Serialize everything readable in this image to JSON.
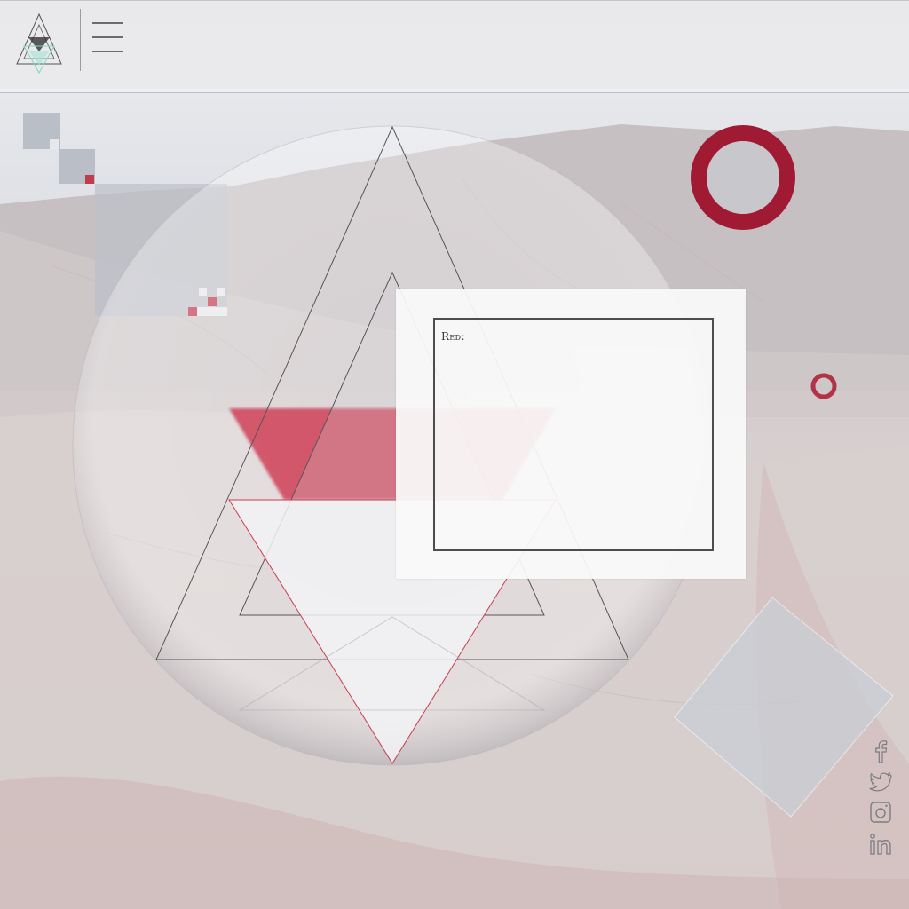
{
  "header": {
    "menu_icon": "hamburger-menu-icon",
    "logo_icon": "triangle-logo-icon"
  },
  "content": {
    "panel_label": "Red:"
  },
  "social": [
    {
      "icon": "facebook-icon"
    },
    {
      "icon": "twitter-icon"
    },
    {
      "icon": "instagram-icon"
    },
    {
      "icon": "linkedin-icon"
    }
  ],
  "colors": {
    "accent_red": "#c23a4b",
    "ring_red": "#a01a33",
    "panel_white": "#fafafa"
  }
}
